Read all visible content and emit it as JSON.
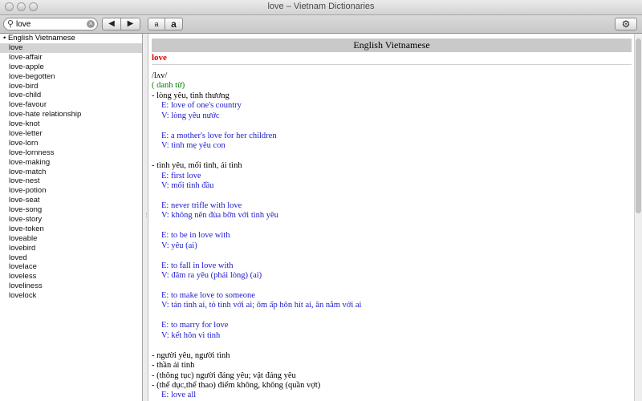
{
  "window": {
    "title": "love – Vietnam Dictionaries"
  },
  "toolbar": {
    "search_value": "love",
    "back_label": "◀",
    "forward_label": "▶",
    "font_small_label": "a",
    "font_large_label": "a",
    "settings_icon": "⚙"
  },
  "sidebar": {
    "dictionary": "English Vietnamese",
    "items": [
      "love",
      "love-affair",
      "love-apple",
      "love-begotten",
      "love-bird",
      "love-child",
      "love-favour",
      "love-hate relationship",
      "love-knot",
      "love-letter",
      "love-lorn",
      "love-lornness",
      "love-making",
      "love-match",
      "love-nest",
      "love-potion",
      "love-seat",
      "love-song",
      "love-story",
      "love-token",
      "loveable",
      "lovebird",
      "loved",
      "lovelace",
      "loveless",
      "loveliness",
      "lovelock"
    ],
    "selected_index": 0
  },
  "entry": {
    "dictionary_header": "English Vietnamese",
    "word": "love",
    "lines": [
      {
        "text": "/lʌv/",
        "style": "blk",
        "indent": false
      },
      {
        "text": "( danh từ)",
        "style": "grn",
        "indent": false
      },
      {
        "text": "- lòng yêu, tình thương",
        "style": "blk",
        "indent": false
      },
      {
        "text": "E: love of one's country",
        "style": "blu",
        "indent": true
      },
      {
        "text": "V: lòng yêu nước",
        "style": "blu",
        "indent": true
      },
      {
        "text": "",
        "style": "blk",
        "indent": false
      },
      {
        "text": "E: a mother's love for her children",
        "style": "blu",
        "indent": true
      },
      {
        "text": "V: tình mẹ yêu con",
        "style": "blu",
        "indent": true
      },
      {
        "text": "",
        "style": "blk",
        "indent": false
      },
      {
        "text": "- tình yêu, mối tình, ái tình",
        "style": "blk",
        "indent": false
      },
      {
        "text": "E: first love",
        "style": "blu",
        "indent": true
      },
      {
        "text": "V: mối tình đầu",
        "style": "blu",
        "indent": true
      },
      {
        "text": "",
        "style": "blk",
        "indent": false
      },
      {
        "text": "E: never trifle with love",
        "style": "blu",
        "indent": true
      },
      {
        "text": "V: không nên đùa bỡn với tình yêu",
        "style": "blu",
        "indent": true
      },
      {
        "text": "",
        "style": "blk",
        "indent": false
      },
      {
        "text": "E: to be in love with",
        "style": "blu",
        "indent": true
      },
      {
        "text": "V: yêu (ai)",
        "style": "blu",
        "indent": true
      },
      {
        "text": "",
        "style": "blk",
        "indent": false
      },
      {
        "text": "E: to fall in love with",
        "style": "blu",
        "indent": true
      },
      {
        "text": "V: đâm ra yêu (phải lòng) (ai)",
        "style": "blu",
        "indent": true
      },
      {
        "text": "",
        "style": "blk",
        "indent": false
      },
      {
        "text": "E: to make love to someone",
        "style": "blu",
        "indent": true
      },
      {
        "text": "V: tán tình ai, tỏ tình với ai; ôm ấp hôn hít ai, ăn nằm với ai",
        "style": "blu",
        "indent": true
      },
      {
        "text": "",
        "style": "blk",
        "indent": false
      },
      {
        "text": "E: to marry for love",
        "style": "blu",
        "indent": true
      },
      {
        "text": "V: kết hôn vì tình",
        "style": "blu",
        "indent": true
      },
      {
        "text": "",
        "style": "blk",
        "indent": false
      },
      {
        "text": "- người yêu, người tình",
        "style": "blk",
        "indent": false
      },
      {
        "text": "- thần ái tình",
        "style": "blk",
        "indent": false
      },
      {
        "text": "- (thông tục) người đáng yêu; vật đáng yêu",
        "style": "blk",
        "indent": false
      },
      {
        "text": "- (thể dục,thể thao) điểm không, không (quần vợt)",
        "style": "blk",
        "indent": false
      },
      {
        "text": "E: love all",
        "style": "blu",
        "indent": true
      }
    ]
  }
}
